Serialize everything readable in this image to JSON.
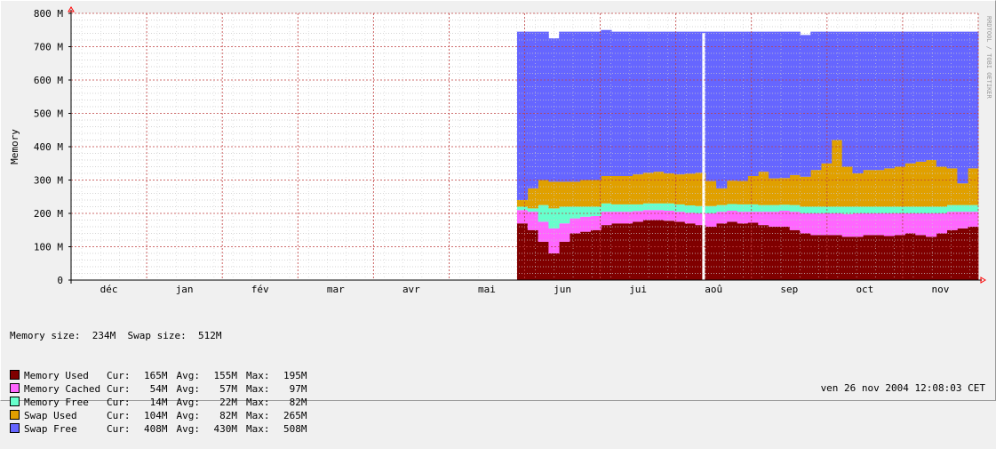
{
  "chart_data": {
    "type": "area",
    "ylabel": "Memory",
    "ylim": [
      0,
      800
    ],
    "yticks": [
      "0",
      "100 M",
      "200 M",
      "300 M",
      "400 M",
      "500 M",
      "600 M",
      "700 M",
      "800 M"
    ],
    "xlabels": [
      "déc",
      "jan",
      "fév",
      "mar",
      "avr",
      "mai",
      "jun",
      "jui",
      "aoû",
      "sep",
      "oct",
      "nov"
    ],
    "watermark": "RRDTOOL / TOBI OETIKER",
    "grid": true,
    "stacked": true,
    "data_start_month_index": 5.9,
    "gap_month_index": 8.35,
    "series": [
      {
        "name": "Memory Used",
        "color": "#800000",
        "values": [
          170,
          150,
          115,
          80,
          115,
          140,
          145,
          150,
          165,
          170,
          170,
          175,
          180,
          180,
          178,
          175,
          170,
          165,
          160,
          170,
          175,
          170,
          172,
          165,
          160,
          160,
          150,
          140,
          135,
          135,
          135,
          130,
          130,
          135,
          135,
          132,
          135,
          140,
          135,
          130,
          140,
          150,
          155,
          160
        ]
      },
      {
        "name": "Memory Cached",
        "color": "#ff66ff",
        "values": [
          40,
          55,
          60,
          75,
          55,
          45,
          45,
          42,
          40,
          35,
          35,
          32,
          30,
          30,
          30,
          30,
          32,
          35,
          40,
          35,
          33,
          35,
          33,
          40,
          45,
          48,
          55,
          60,
          65,
          65,
          65,
          68,
          70,
          65,
          65,
          68,
          65,
          60,
          65,
          70,
          60,
          55,
          50,
          45
        ]
      },
      {
        "name": "Memory Free",
        "color": "#66ffcc",
        "values": [
          10,
          10,
          50,
          60,
          50,
          35,
          30,
          28,
          25,
          22,
          22,
          20,
          20,
          20,
          22,
          22,
          22,
          22,
          22,
          20,
          20,
          22,
          22,
          20,
          20,
          18,
          20,
          20,
          20,
          20,
          20,
          22,
          20,
          20,
          20,
          20,
          20,
          20,
          20,
          20,
          20,
          20,
          20,
          20
        ]
      },
      {
        "name": "Swap Used",
        "color": "#e0a000",
        "values": [
          20,
          60,
          75,
          80,
          75,
          75,
          80,
          80,
          82,
          85,
          85,
          90,
          92,
          95,
          90,
          90,
          95,
          100,
          75,
          50,
          70,
          70,
          85,
          100,
          80,
          80,
          90,
          90,
          110,
          130,
          200,
          120,
          100,
          110,
          110,
          115,
          120,
          130,
          135,
          140,
          120,
          110,
          65,
          110
        ]
      },
      {
        "name": "Swap Free",
        "color": "#6666ff",
        "values": [
          505,
          470,
          445,
          430,
          450,
          450,
          445,
          445,
          438,
          433,
          433,
          428,
          423,
          420,
          425,
          428,
          426,
          423,
          448,
          470,
          447,
          448,
          433,
          420,
          440,
          439,
          430,
          425,
          415,
          395,
          325,
          405,
          425,
          415,
          415,
          410,
          405,
          395,
          390,
          385,
          405,
          410,
          455,
          410
        ]
      }
    ],
    "summary": {
      "memory_size_label": "Memory size:",
      "memory_size_value": "234M",
      "swap_size_label": "Swap size:",
      "swap_size_value": "512M"
    },
    "legend": [
      {
        "name": "Memory Used",
        "color": "#800000",
        "cur_label": "Cur:",
        "cur": "165M",
        "avg_label": "Avg:",
        "avg": "155M",
        "max_label": "Max:",
        "max": "195M"
      },
      {
        "name": "Memory Cached",
        "color": "#ff66ff",
        "cur_label": "Cur:",
        "cur": "54M",
        "avg_label": "Avg:",
        "avg": "57M",
        "max_label": "Max:",
        "max": "97M"
      },
      {
        "name": "Memory Free",
        "color": "#66ffcc",
        "cur_label": "Cur:",
        "cur": "14M",
        "avg_label": "Avg:",
        "avg": "22M",
        "max_label": "Max:",
        "max": "82M"
      },
      {
        "name": "Swap Used",
        "color": "#e0a000",
        "cur_label": "Cur:",
        "cur": "104M",
        "avg_label": "Avg:",
        "avg": "82M",
        "max_label": "Max:",
        "max": "265M"
      },
      {
        "name": "Swap Free",
        "color": "#6666ff",
        "cur_label": "Cur:",
        "cur": "408M",
        "avg_label": "Avg:",
        "avg": "430M",
        "max_label": "Max:",
        "max": "508M"
      }
    ],
    "timestamp": "ven 26 nov 2004 12:08:03 CET"
  }
}
